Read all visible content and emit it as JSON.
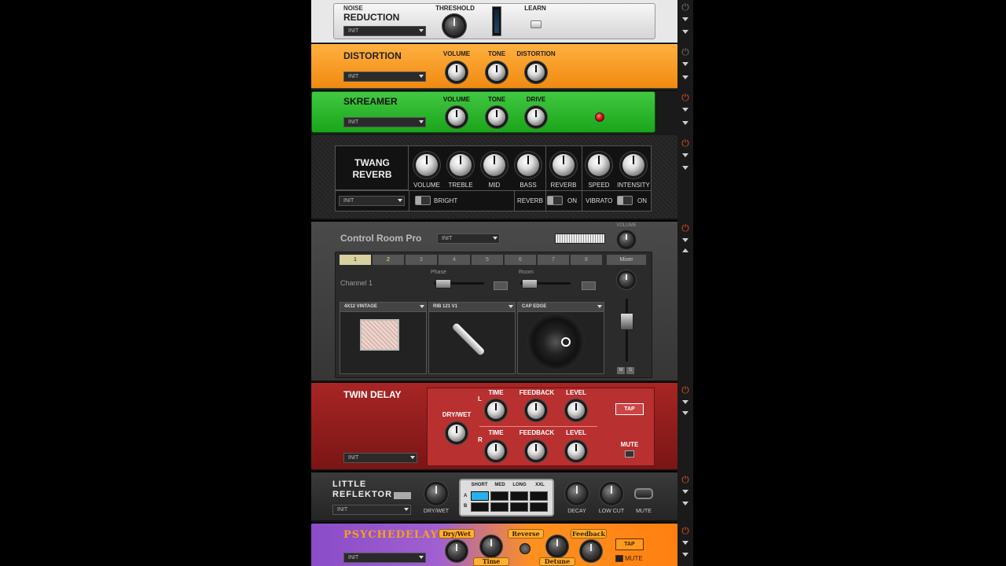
{
  "noise": {
    "title_line1": "NOISE",
    "title_line2": "REDUCTION",
    "preset": "INIT",
    "threshold_label": "THRESHOLD",
    "learn_label": "LEARN"
  },
  "distortion": {
    "title": "DISTORTION",
    "preset": "INIT",
    "knobs": [
      "VOLUME",
      "TONE",
      "DISTORTION"
    ]
  },
  "skreamer": {
    "title": "SKREAMER",
    "preset": "INIT",
    "knobs": [
      "VOLUME",
      "TONE",
      "DRIVE"
    ]
  },
  "twang": {
    "title_line1": "TWANG",
    "title_line2": "REVERB",
    "preset": "INIT",
    "knobs": [
      "VOLUME",
      "TREBLE",
      "MID",
      "BASS",
      "REVERB",
      "SPEED",
      "INTENSITY"
    ],
    "bright": "BRIGHT",
    "reverb": "REVERB",
    "vibrato": "VIBRATO",
    "on": "ON"
  },
  "crp": {
    "title": "Control Room Pro",
    "preset": "INIT",
    "volume_label": "VOLUME",
    "tabs": [
      "1",
      "2",
      "3",
      "4",
      "5",
      "6",
      "7",
      "8"
    ],
    "mixer": "Mixer",
    "channel": "Channel 1",
    "phase": "Phase",
    "room": "Room",
    "cab": "4X12 VINTAGE",
    "mic": "RIB 121 V1",
    "pos": "CAP EDGE",
    "m": "M",
    "s": "S"
  },
  "twin": {
    "title": "TWIN DELAY",
    "preset": "INIT",
    "drywet": "DRY/WET",
    "top": [
      "TIME",
      "FEEDBACK",
      "LEVEL"
    ],
    "bottom": [
      "TIME",
      "FEEDBACK",
      "LEVEL"
    ],
    "l": "L",
    "r": "R",
    "tap": "TAP",
    "mute": "MUTE"
  },
  "reflektor": {
    "title_line1": "LITTLE",
    "title_line2": "REFLEKTOR",
    "preset": "INIT",
    "drywet": "DRY/WET",
    "decay": "DECAY",
    "lowcut": "LOW CUT",
    "mute": "MUTE",
    "sizes": [
      "SHORT",
      "MED",
      "LONG",
      "XXL"
    ],
    "rows": [
      "A",
      "B"
    ]
  },
  "psych": {
    "title": "PSYCHEDELAY",
    "preset": "INIT",
    "drywet": "Dry/Wet",
    "reverse": "Reverse",
    "feedback": "Feedback",
    "time": "Time",
    "detune": "Detune",
    "tap": "TAP",
    "mute": "MUTE"
  }
}
